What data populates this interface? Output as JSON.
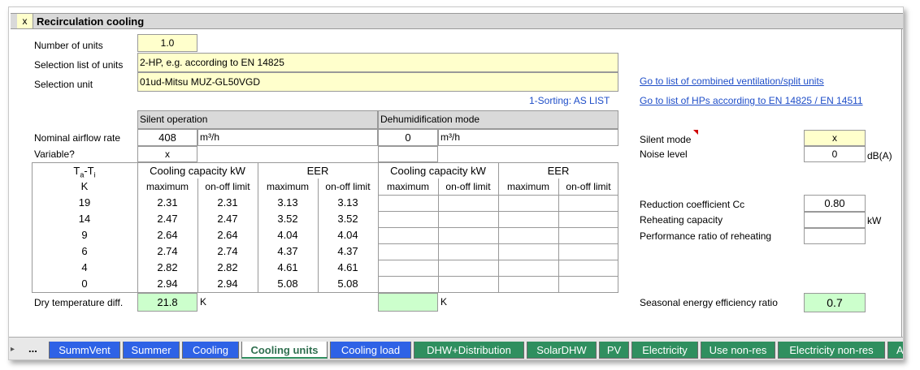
{
  "section": {
    "toggle": "x",
    "title": "Recirculation cooling"
  },
  "labels": {
    "units": "Number of units",
    "selection_list": "Selection list of units",
    "selection_unit": "Selection unit",
    "sorting": "1-Sorting: AS LIST",
    "nominal_airflow": "Nominal airflow rate",
    "variable": "Variable?",
    "dry_temp": "Dry temperature diff.",
    "silent_mode": "Silent mode",
    "noise_level": "Noise level",
    "reduction": "Reduction coefficient Cc",
    "reheating": "Reheating capacity",
    "perf_ratio": "Performance ratio of reheating",
    "seer": "Seasonal energy efficiency ratio"
  },
  "values": {
    "units": "1.0",
    "selection_list": "2-HP, e.g. according to EN 14825",
    "selection_unit": "01ud-Mitsu MUZ-GL50VGD",
    "silent_airflow": "408",
    "dehum_airflow": "0",
    "variable": "x",
    "dry_temp_silent": "21.8",
    "silent_mode": "x",
    "noise_level": "0",
    "reduction": "0.80",
    "seer": "0.7"
  },
  "units": {
    "airflow": "m³/h",
    "airflow2": "m³/h",
    "kelvin": "K",
    "kelvin2": "K",
    "dba": "dB(A)",
    "kw": "kW"
  },
  "links": {
    "ventilation": "Go to list of combined ventilation/split units",
    "hps": "Go to list of HPs according to EN 14825 / EN 14511"
  },
  "table": {
    "silent_header": "Silent operation",
    "dehum_header": "Dehumidification mode",
    "tt_header": "Ta-Ti",
    "tt_unit": "K",
    "cc_header": "Cooling capacity kW",
    "eer_header": "EER",
    "cc_header2": "Cooling capacity kW",
    "eer_header2": "EER",
    "sub": [
      "maximum",
      "on-off limit",
      "maximum",
      "on-off limit",
      "maximum",
      "on-off limit",
      "maximum",
      "on-off limit"
    ],
    "rows": [
      {
        "t": "19",
        "cc_max": "2.31",
        "cc_lim": "2.31",
        "eer_max": "3.13",
        "eer_lim": "3.13"
      },
      {
        "t": "14",
        "cc_max": "2.47",
        "cc_lim": "2.47",
        "eer_max": "3.52",
        "eer_lim": "3.52"
      },
      {
        "t": "9",
        "cc_max": "2.64",
        "cc_lim": "2.64",
        "eer_max": "4.04",
        "eer_lim": "4.04"
      },
      {
        "t": "6",
        "cc_max": "2.74",
        "cc_lim": "2.74",
        "eer_max": "4.37",
        "eer_lim": "4.37"
      },
      {
        "t": "4",
        "cc_max": "2.82",
        "cc_lim": "2.82",
        "eer_max": "4.61",
        "eer_lim": "4.61"
      },
      {
        "t": "0",
        "cc_max": "2.94",
        "cc_lim": "2.94",
        "eer_max": "5.08",
        "eer_lim": "5.08"
      }
    ]
  },
  "tabs": {
    "ellipsis": "...",
    "items": [
      "SummVent",
      "Summer",
      "Cooling",
      "Cooling units",
      "Cooling load",
      "DHW+Distribution",
      "SolarDHW",
      "PV",
      "Electricity",
      "Use non-res",
      "Electricity non-res",
      "Au"
    ],
    "active": "Cooling units"
  },
  "colors": {
    "input_yellow": "#ffffcc",
    "result_green": "#ccffcc",
    "tab_blue": "#2e62e6",
    "tab_green": "#2f8f5f",
    "link": "#1f4ec8"
  }
}
